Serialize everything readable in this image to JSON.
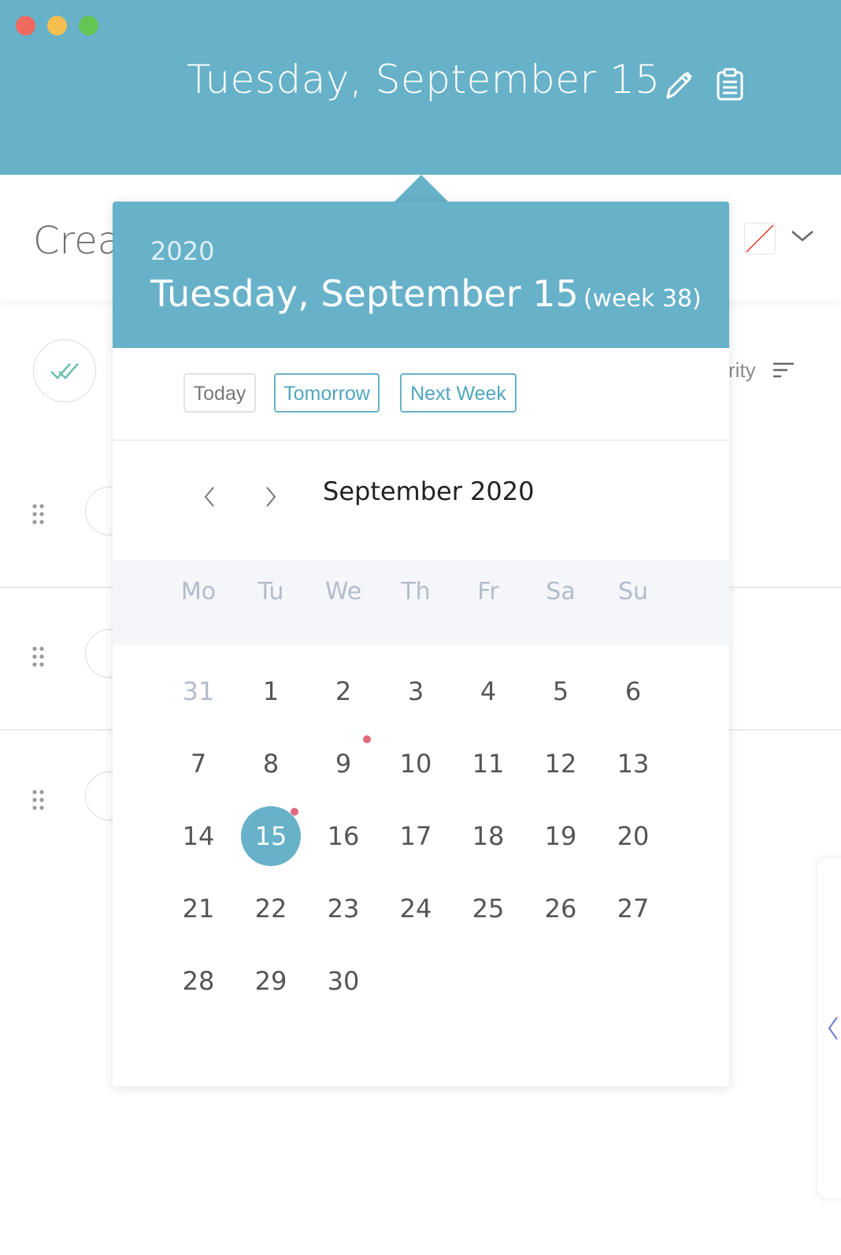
{
  "window": {
    "title": "Tuesday, September 15"
  },
  "header": {
    "icons": [
      "pencil-icon",
      "clipboard-icon"
    ]
  },
  "background": {
    "create_label": "Creat",
    "sort_label": "rity"
  },
  "datepicker": {
    "year": "2020",
    "date": "Tuesday, September 15",
    "week": "(week 38)",
    "quick": {
      "today": "Today",
      "tomorrow": "Tomorrow",
      "next_week": "Next Week"
    },
    "month_title": "September 2020",
    "weekdays": [
      "Mo",
      "Tu",
      "We",
      "Th",
      "Fr",
      "Sa",
      "Su"
    ],
    "weeks": [
      [
        "31",
        "1",
        "2",
        "3",
        "4",
        "5",
        "6"
      ],
      [
        "7",
        "8",
        "9",
        "10",
        "11",
        "12",
        "13"
      ],
      [
        "14",
        "15",
        "16",
        "17",
        "18",
        "19",
        "20"
      ],
      [
        "21",
        "22",
        "23",
        "24",
        "25",
        "26",
        "27"
      ],
      [
        "28",
        "29",
        "30"
      ]
    ],
    "selected_day": "15",
    "days_with_events": [
      "9",
      "15"
    ],
    "accent_color": "#67b1c9",
    "event_dot_color": "#e06b7c"
  }
}
